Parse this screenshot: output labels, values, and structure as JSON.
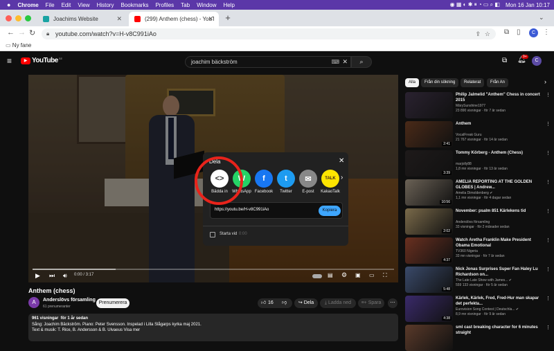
{
  "os_menubar": {
    "items": [
      "Chrome",
      "File",
      "Edit",
      "View",
      "History",
      "Bookmarks",
      "Profiles",
      "Tab",
      "Window",
      "Help"
    ],
    "clock": "Mon 16 Jan 10:17"
  },
  "browser": {
    "tabs": [
      {
        "title": "Joachims Website"
      },
      {
        "title": "(299) Anthem (chess) - YouTub"
      }
    ],
    "url": "youtube.com/watch?v=H-v8C991iAo",
    "bookmark": "Ny fane"
  },
  "youtube": {
    "logo": "YouTube",
    "logo_country": "SE",
    "search_query": "joachim bäckström",
    "notif_badge": "9+",
    "avatar_letter": "C"
  },
  "player": {
    "time": "0:00 / 3:17",
    "progress": 0.0
  },
  "share_dialog": {
    "title": "Dela",
    "targets": [
      {
        "label": "Bädda in",
        "icon": "<>",
        "color": "#ffffff",
        "fg": "#333"
      },
      {
        "label": "WhatsApp",
        "icon": "W",
        "color": "#25d366",
        "fg": "#fff"
      },
      {
        "label": "Facebook",
        "icon": "f",
        "color": "#1877f2",
        "fg": "#fff"
      },
      {
        "label": "Twitter",
        "icon": "t",
        "color": "#1d9bf0",
        "fg": "#fff"
      },
      {
        "label": "E-post",
        "icon": "✉",
        "color": "#888888",
        "fg": "#fff"
      },
      {
        "label": "KakaoTalk",
        "icon": "TALK",
        "color": "#fee500",
        "fg": "#3a1d1d"
      }
    ],
    "link": "https://youtu.be/H-v8C991iAo",
    "copy_label": "Kopiera",
    "start_label": "Starta vid",
    "start_time": "0:00"
  },
  "video_info": {
    "title": "Anthem (chess)",
    "channel": "Anderslövs församling",
    "channel_avatar": "A",
    "subscribers": "61 prenumeranter",
    "subscribe_label": "Prenumerera",
    "likes": "16",
    "share_label": "Dela",
    "download_label": "Ladda ned",
    "save_label": "Spara",
    "views_date": "961 visningar  för 1 år sedan",
    "desc_line1": "Sång: Joachim Bäckström. Piano: Peter Svensson. Inspelad i Lilla Slågarps kyrka maj 2021.",
    "desc_line2": "Text & musik: T. Rice, B. Andersson & B. Ulvaeus Visa mer"
  },
  "sidebar": {
    "chips": [
      "Alla",
      "Från din sökning",
      "Relaterat",
      "Från An"
    ],
    "items": [
      {
        "title": "Philip Jalmelid \"Anthem\" Chess in concert 2015",
        "channel": "MärySunshine1977",
        "meta": "23 890 visningar · för 7 år sedan",
        "duration": "",
        "thumb": "#2a2230"
      },
      {
        "title": "Anthem",
        "channel": "VocalFreak Guru",
        "meta": "21 767 visningar · för 14 år sedan",
        "duration": "2:41",
        "thumb": "#4a2a18"
      },
      {
        "title": "Tommy Körberg - Anthem (Chess)",
        "channel": "marjolly88",
        "meta": "1,8 mn visningar · för 13 år sedan",
        "duration": "3:39",
        "thumb": "#1e1a1a"
      },
      {
        "title": "AMELIA REPORTING AT THE GOLDEN GLOBES | Andrew...",
        "channel": "Amelia Dimoldenberg ✔",
        "meta": "1,1 mn visningar · för 4 dagar sedan",
        "duration": "10:56",
        "thumb": "#6b6256"
      },
      {
        "title": "November: psalm 851 Kärlekens tid",
        "channel": "Anderslövs församling",
        "meta": "33 visningar · för 2 månader sedan",
        "duration": "2:02",
        "thumb": "#7a6a4a"
      },
      {
        "title": "Watch Aretha Franklin Make President Obama Emotional",
        "channel": "TV360 Nigeria",
        "meta": "33 mn visningar · för 7 år sedan",
        "duration": "4:37",
        "thumb": "#6a3020"
      },
      {
        "title": "Nick Jonas Surprises Super Fan Haley Lu Richardson on...",
        "channel": "The Late Late Show with James... ✔",
        "meta": "559 133 visningar · för 5 år sedan",
        "duration": "5:48",
        "thumb": "#3a4a6a"
      },
      {
        "title": "Kärlek, Kärlek, Fred, Fred-Hur man skapar det perfekta...",
        "channel": "Eurovision Song Contest | Deutschla... ✔",
        "meta": "8,9 mn visningar · för 9 år sedan",
        "duration": "4:38",
        "thumb": "#3a2a6a"
      },
      {
        "title": "sml cast breaking character for 6 minutes straight",
        "channel": "",
        "meta": "",
        "duration": "",
        "thumb": "#5a3a2a"
      }
    ]
  },
  "colors": {
    "menubar": "#5b37a8",
    "yt_red": "#ff0000",
    "annotation_circle": "#e8231b",
    "copy_button": "#3ea6ff"
  }
}
